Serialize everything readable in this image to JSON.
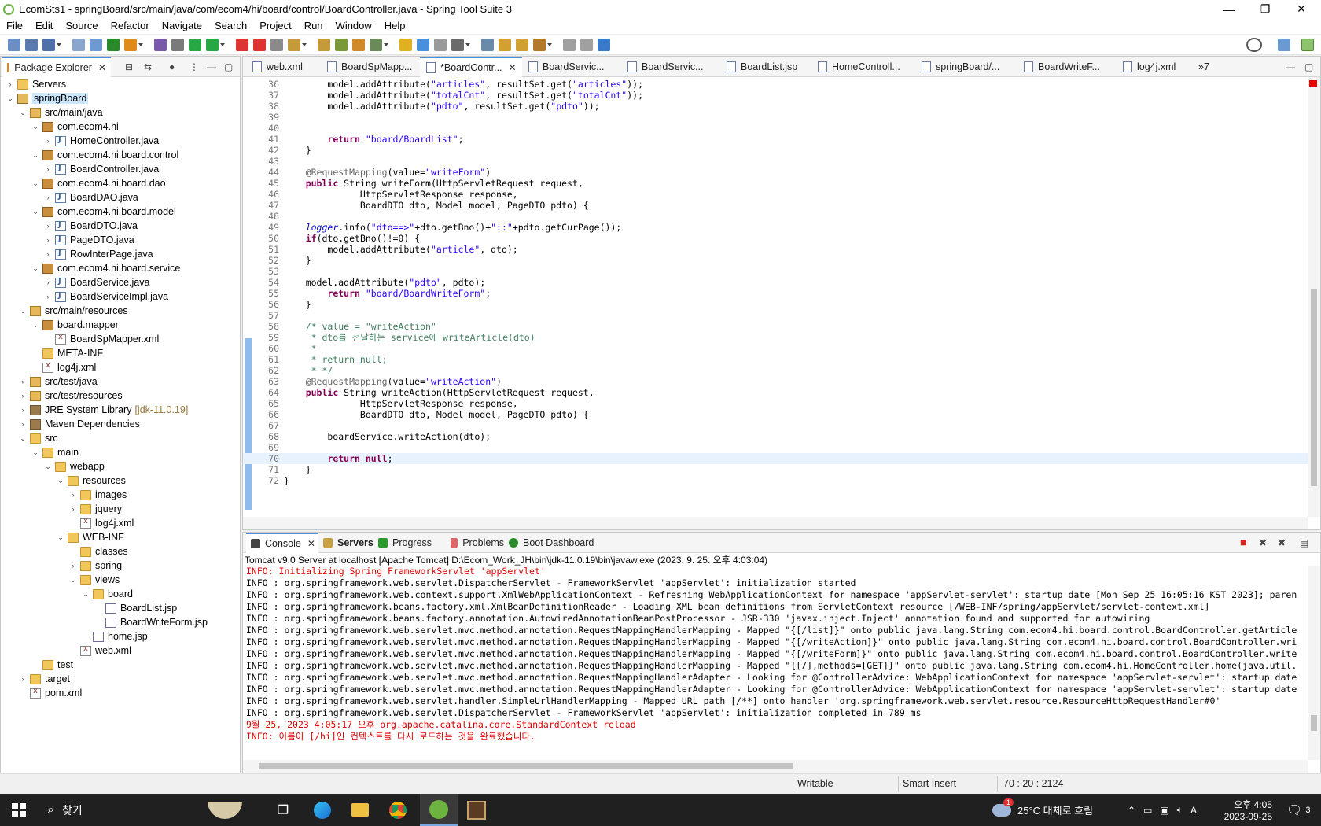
{
  "window": {
    "title": "EcomSts1 - springBoard/src/main/java/com/ecom4/hi/board/control/BoardController.java - Spring Tool Suite 3"
  },
  "menu": [
    "File",
    "Edit",
    "Source",
    "Refactor",
    "Navigate",
    "Search",
    "Project",
    "Run",
    "Window",
    "Help"
  ],
  "package_explorer": {
    "tab_label": "Package Explorer",
    "tree": [
      {
        "label": "Servers",
        "icon": "folder",
        "depth": 0,
        "toggle": "›"
      },
      {
        "label": "springBoard",
        "icon": "project",
        "depth": 0,
        "toggle": "⌄",
        "selected": true
      },
      {
        "label": "src/main/java",
        "icon": "src",
        "depth": 1,
        "toggle": "⌄"
      },
      {
        "label": "com.ecom4.hi",
        "icon": "pkg",
        "depth": 2,
        "toggle": "⌄"
      },
      {
        "label": "HomeController.java",
        "icon": "java",
        "depth": 3,
        "toggle": "›"
      },
      {
        "label": "com.ecom4.hi.board.control",
        "icon": "pkg",
        "depth": 2,
        "toggle": "⌄"
      },
      {
        "label": "BoardController.java",
        "icon": "java",
        "depth": 3,
        "toggle": "›"
      },
      {
        "label": "com.ecom4.hi.board.dao",
        "icon": "pkg",
        "depth": 2,
        "toggle": "⌄"
      },
      {
        "label": "BoardDAO.java",
        "icon": "java",
        "depth": 3,
        "toggle": "›"
      },
      {
        "label": "com.ecom4.hi.board.model",
        "icon": "pkg",
        "depth": 2,
        "toggle": "⌄"
      },
      {
        "label": "BoardDTO.java",
        "icon": "java",
        "depth": 3,
        "toggle": "›"
      },
      {
        "label": "PageDTO.java",
        "icon": "java",
        "depth": 3,
        "toggle": "›"
      },
      {
        "label": "RowInterPage.java",
        "icon": "java",
        "depth": 3,
        "toggle": "›"
      },
      {
        "label": "com.ecom4.hi.board.service",
        "icon": "pkg",
        "depth": 2,
        "toggle": "⌄"
      },
      {
        "label": "BoardService.java",
        "icon": "java",
        "depth": 3,
        "toggle": "›"
      },
      {
        "label": "BoardServiceImpl.java",
        "icon": "java",
        "depth": 3,
        "toggle": "›"
      },
      {
        "label": "src/main/resources",
        "icon": "src",
        "depth": 1,
        "toggle": "⌄"
      },
      {
        "label": "board.mapper",
        "icon": "pkg",
        "depth": 2,
        "toggle": "⌄"
      },
      {
        "label": "BoardSpMapper.xml",
        "icon": "xml",
        "depth": 3,
        "toggle": ""
      },
      {
        "label": "META-INF",
        "icon": "folder",
        "depth": 2,
        "toggle": ""
      },
      {
        "label": "log4j.xml",
        "icon": "xml",
        "depth": 2,
        "toggle": ""
      },
      {
        "label": "src/test/java",
        "icon": "src",
        "depth": 1,
        "toggle": "›"
      },
      {
        "label": "src/test/resources",
        "icon": "src",
        "depth": 1,
        "toggle": "›"
      },
      {
        "label": "JRE System Library",
        "suffix": "[jdk-11.0.19]",
        "icon": "lib",
        "depth": 1,
        "toggle": "›"
      },
      {
        "label": "Maven Dependencies",
        "icon": "lib",
        "depth": 1,
        "toggle": "›"
      },
      {
        "label": "src",
        "icon": "folder",
        "depth": 1,
        "toggle": "⌄"
      },
      {
        "label": "main",
        "icon": "folder",
        "depth": 2,
        "toggle": "⌄"
      },
      {
        "label": "webapp",
        "icon": "folder",
        "depth": 3,
        "toggle": "⌄"
      },
      {
        "label": "resources",
        "icon": "folder",
        "depth": 4,
        "toggle": "⌄"
      },
      {
        "label": "images",
        "icon": "folder",
        "depth": 5,
        "toggle": "›"
      },
      {
        "label": "jquery",
        "icon": "folder",
        "depth": 5,
        "toggle": "›"
      },
      {
        "label": "log4j.xml",
        "icon": "xml",
        "depth": 5,
        "toggle": ""
      },
      {
        "label": "WEB-INF",
        "icon": "folder",
        "depth": 4,
        "toggle": "⌄"
      },
      {
        "label": "classes",
        "icon": "folder",
        "depth": 5,
        "toggle": ""
      },
      {
        "label": "spring",
        "icon": "folder",
        "depth": 5,
        "toggle": "›"
      },
      {
        "label": "views",
        "icon": "folder",
        "depth": 5,
        "toggle": "⌄"
      },
      {
        "label": "board",
        "icon": "folder",
        "depth": 6,
        "toggle": "⌄"
      },
      {
        "label": "BoardList.jsp",
        "icon": "jsp",
        "depth": 7,
        "toggle": ""
      },
      {
        "label": "BoardWriteForm.jsp",
        "icon": "jsp",
        "depth": 7,
        "toggle": ""
      },
      {
        "label": "home.jsp",
        "icon": "jsp",
        "depth": 6,
        "toggle": ""
      },
      {
        "label": "web.xml",
        "icon": "xml",
        "depth": 5,
        "toggle": ""
      },
      {
        "label": "test",
        "icon": "folder",
        "depth": 2,
        "toggle": ""
      },
      {
        "label": "target",
        "icon": "folder",
        "depth": 1,
        "toggle": "›"
      },
      {
        "label": "pom.xml",
        "icon": "xml",
        "depth": 1,
        "toggle": ""
      }
    ]
  },
  "editor": {
    "tabs": [
      "web.xml",
      "BoardSpMapp...",
      "*BoardContr...",
      "BoardServic...",
      "BoardServic...",
      "BoardList.jsp",
      "HomeControll...",
      "springBoard/...",
      "BoardWriteF...",
      "log4j.xml",
      "»7"
    ],
    "active_tab": 2,
    "lines": [
      {
        "n": "36",
        "text": "        model.addAttribute(\"articles\", resultSet.get(\"articles\"));"
      },
      {
        "n": "37",
        "text": "        model.addAttribute(\"totalCnt\", resultSet.get(\"totalCnt\"));"
      },
      {
        "n": "38",
        "text": "        model.addAttribute(\"pdto\", resultSet.get(\"pdto\"));"
      },
      {
        "n": "39",
        "text": ""
      },
      {
        "n": "40",
        "text": ""
      },
      {
        "n": "41",
        "text": "        return \"board/BoardList\";"
      },
      {
        "n": "42",
        "text": "    }"
      },
      {
        "n": "43",
        "text": ""
      },
      {
        "n": "44",
        "text": "    @RequestMapping(value=\"writeForm\")"
      },
      {
        "n": "45",
        "text": "    public String writeForm(HttpServletRequest request,"
      },
      {
        "n": "46",
        "text": "              HttpServletResponse response,"
      },
      {
        "n": "47",
        "text": "              BoardDTO dto, Model model, PageDTO pdto) {"
      },
      {
        "n": "48",
        "text": ""
      },
      {
        "n": "49",
        "text": "    logger.info(\"dto==>\"+dto.getBno()+\"::\"+pdto.getCurPage());"
      },
      {
        "n": "50",
        "text": "    if(dto.getBno()!=0) {"
      },
      {
        "n": "51",
        "text": "        model.addAttribute(\"article\", dto);"
      },
      {
        "n": "52",
        "text": "    }"
      },
      {
        "n": "53",
        "text": ""
      },
      {
        "n": "54",
        "text": "    model.addAttribute(\"pdto\", pdto);"
      },
      {
        "n": "55",
        "text": "        return \"board/BoardWriteForm\";"
      },
      {
        "n": "56",
        "text": "    }"
      },
      {
        "n": "57",
        "text": ""
      },
      {
        "n": "58",
        "text": "    /* value = \"writeAction\""
      },
      {
        "n": "59",
        "text": "     * dto를 전달하는 service에 writeArticle(dto)"
      },
      {
        "n": "60",
        "text": "     *"
      },
      {
        "n": "61",
        "text": "     * return null;"
      },
      {
        "n": "62",
        "text": "     * */"
      },
      {
        "n": "63",
        "text": "    @RequestMapping(value=\"writeAction\")"
      },
      {
        "n": "64",
        "text": "    public String writeAction(HttpServletRequest request,"
      },
      {
        "n": "65",
        "text": "              HttpServletResponse response,"
      },
      {
        "n": "66",
        "text": "              BoardDTO dto, Model model, PageDTO pdto) {"
      },
      {
        "n": "67",
        "text": ""
      },
      {
        "n": "68",
        "text": "        boardService.writeAction(dto);"
      },
      {
        "n": "69",
        "text": ""
      },
      {
        "n": "70",
        "text": "        return null;"
      },
      {
        "n": "71",
        "text": "    }"
      },
      {
        "n": "72",
        "text": "}"
      }
    ],
    "current_line": "70"
  },
  "console": {
    "tabs": [
      "Console",
      "Servers",
      "Progress",
      "Problems",
      "Boot Dashboard"
    ],
    "header": "Tomcat v9.0 Server at localhost [Apache Tomcat] D:\\Ecom_Work_JH\\bin\\jdk-11.0.19\\bin\\javaw.exe  (2023. 9. 25. 오후 4:03:04)",
    "lines": [
      {
        "text": "INFO: Initializing Spring FrameworkServlet 'appServlet'",
        "red": true
      },
      {
        "text": "INFO : org.springframework.web.servlet.DispatcherServlet - FrameworkServlet 'appServlet': initialization started",
        "red": false
      },
      {
        "text": "INFO : org.springframework.web.context.support.XmlWebApplicationContext - Refreshing WebApplicationContext for namespace 'appServlet-servlet': startup date [Mon Sep 25 16:05:16 KST 2023]; paren",
        "red": false
      },
      {
        "text": "INFO : org.springframework.beans.factory.xml.XmlBeanDefinitionReader - Loading XML bean definitions from ServletContext resource [/WEB-INF/spring/appServlet/servlet-context.xml]",
        "red": false
      },
      {
        "text": "INFO : org.springframework.beans.factory.annotation.AutowiredAnnotationBeanPostProcessor - JSR-330 'javax.inject.Inject' annotation found and supported for autowiring",
        "red": false
      },
      {
        "text": "INFO : org.springframework.web.servlet.mvc.method.annotation.RequestMappingHandlerMapping - Mapped \"{[/list]}\" onto public java.lang.String com.ecom4.hi.board.control.BoardController.getArticle",
        "red": false
      },
      {
        "text": "INFO : org.springframework.web.servlet.mvc.method.annotation.RequestMappingHandlerMapping - Mapped \"{[/writeAction]}\" onto public java.lang.String com.ecom4.hi.board.control.BoardController.wri",
        "red": false
      },
      {
        "text": "INFO : org.springframework.web.servlet.mvc.method.annotation.RequestMappingHandlerMapping - Mapped \"{[/writeForm]}\" onto public java.lang.String com.ecom4.hi.board.control.BoardController.write",
        "red": false
      },
      {
        "text": "INFO : org.springframework.web.servlet.mvc.method.annotation.RequestMappingHandlerMapping - Mapped \"{[/],methods=[GET]}\" onto public java.lang.String com.ecom4.hi.HomeController.home(java.util.",
        "red": false
      },
      {
        "text": "INFO : org.springframework.web.servlet.mvc.method.annotation.RequestMappingHandlerAdapter - Looking for @ControllerAdvice: WebApplicationContext for namespace 'appServlet-servlet': startup date",
        "red": false
      },
      {
        "text": "INFO : org.springframework.web.servlet.mvc.method.annotation.RequestMappingHandlerAdapter - Looking for @ControllerAdvice: WebApplicationContext for namespace 'appServlet-servlet': startup date",
        "red": false
      },
      {
        "text": "INFO : org.springframework.web.servlet.handler.SimpleUrlHandlerMapping - Mapped URL path [/**] onto handler 'org.springframework.web.servlet.resource.ResourceHttpRequestHandler#0'",
        "red": false
      },
      {
        "text": "INFO : org.springframework.web.servlet.DispatcherServlet - FrameworkServlet 'appServlet': initialization completed in 789 ms",
        "red": false
      },
      {
        "text": "9월 25, 2023 4:05:17 오후 org.apache.catalina.core.StandardContext reload",
        "red": true
      },
      {
        "text": "INFO: 이름이 [/hi]인 컨텍스트를 다시 로드하는 것을 완료했습니다.",
        "red": true
      }
    ]
  },
  "status": {
    "writable": "Writable",
    "insert_mode": "Smart Insert",
    "position": "70 : 20 : 2124"
  },
  "taskbar": {
    "search_label": "찾기",
    "weather": "25°C 대체로 흐림",
    "ime": "A",
    "time": "오후 4:05",
    "date": "2023-09-25",
    "notification_count": "3",
    "weather_badge": "1"
  },
  "colors": {
    "accent": "#4a8fdb",
    "error_red": "#d00000",
    "keyword": "#7f0055",
    "string": "#2a00ff",
    "comment": "#3f7f5f"
  }
}
